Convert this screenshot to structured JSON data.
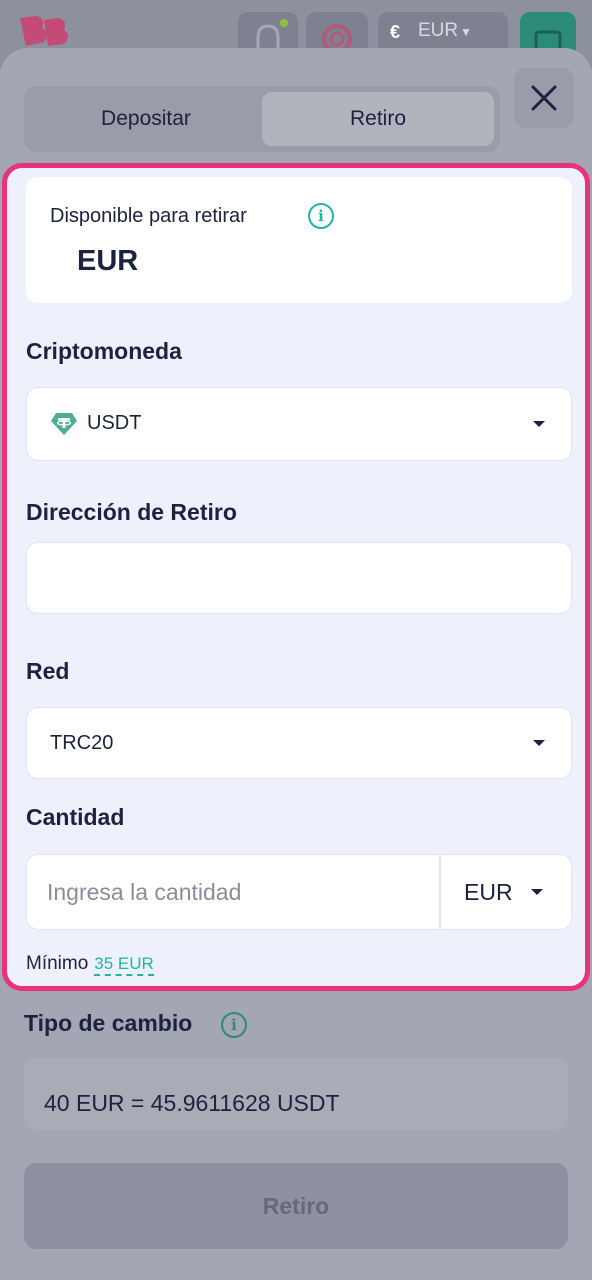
{
  "header": {
    "currency_symbol": "€",
    "currency_code": "EUR"
  },
  "tabs": [
    {
      "label": "Depositar",
      "active": false
    },
    {
      "label": "Retiro",
      "active": true
    }
  ],
  "available": {
    "label": "Disponible para retirar",
    "value": "EUR"
  },
  "crypto": {
    "title": "Criptomoneda",
    "selected": "USDT",
    "icon": "tether-icon"
  },
  "address": {
    "title": "Dirección de Retiro",
    "value": ""
  },
  "network": {
    "title": "Red",
    "selected": "TRC20"
  },
  "amount": {
    "title": "Cantidad",
    "placeholder": "Ingresa la cantidad",
    "currency": "EUR",
    "minimum_label": "Mínimo",
    "minimum_value": "35 EUR"
  },
  "exchange_rate": {
    "title": "Tipo de cambio",
    "value": "40 EUR = 45.9611628 USDT"
  },
  "submit": {
    "label": "Retiro"
  },
  "colors": {
    "accent": "#1fb5a3",
    "highlight_border": "#e8327a",
    "text": "#1c2240"
  }
}
